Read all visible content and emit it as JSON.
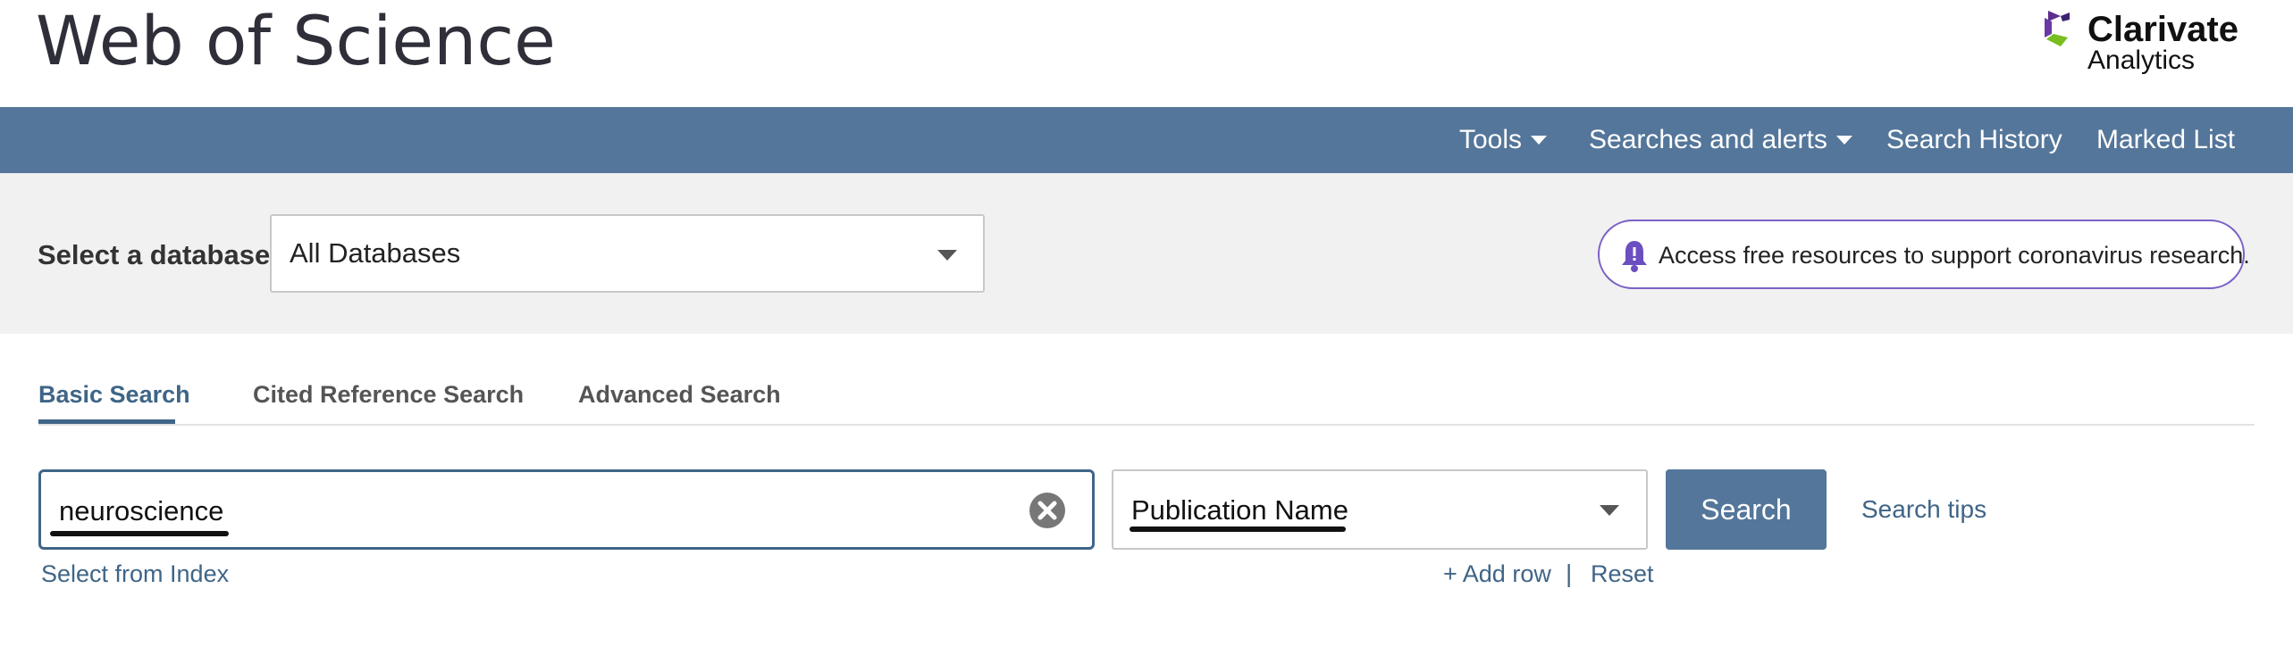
{
  "header": {
    "title": "Web of Science",
    "brand": {
      "name": "Clarivate",
      "sub": "Analytics",
      "icon": "clarivate-logo-mark"
    }
  },
  "navbar": {
    "items": [
      {
        "label": "Tools",
        "has_dropdown": true
      },
      {
        "label": "Searches and alerts",
        "has_dropdown": true
      },
      {
        "label": "Search History",
        "has_dropdown": false
      },
      {
        "label": "Marked List",
        "has_dropdown": false
      }
    ]
  },
  "database": {
    "label": "Select a database",
    "selected": "All Databases",
    "icon": "chevron-down-icon"
  },
  "notice": {
    "icon": "bell-icon",
    "text": "Access free resources to support coronavirus research."
  },
  "tabs": [
    {
      "label": "Basic Search",
      "active": true
    },
    {
      "label": "Cited Reference Search",
      "active": false
    },
    {
      "label": "Advanced Search",
      "active": false
    }
  ],
  "search": {
    "value": "neuroscience",
    "clear_icon": "clear-icon",
    "field": "Publication Name",
    "button": "Search",
    "tips": "Search tips",
    "select_from_index": "Select from Index",
    "add_row": "+ Add row",
    "separator": "|",
    "reset": "Reset"
  },
  "colors": {
    "nav_bg": "#54769a",
    "accent": "#3f6587",
    "band_bg": "#f1f1f1",
    "notice_border": "#7b61c6"
  }
}
